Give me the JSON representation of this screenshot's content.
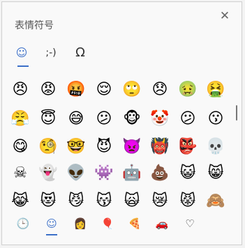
{
  "window": {
    "title": "表情符号",
    "close_glyph": "✕"
  },
  "tabs": [
    {
      "name": "emoji",
      "glyph": "☺"
    },
    {
      "name": "kaomoji",
      "glyph": ";-)"
    },
    {
      "name": "symbols",
      "glyph": "Ω"
    }
  ],
  "emoji_rows": [
    [
      "😠",
      "😡",
      "🤬",
      "😌",
      "🙄",
      "😞",
      "🤢",
      "🤮"
    ],
    [
      "😤",
      "😇",
      "😅",
      "😕",
      "🐵",
      "🤡",
      "😕",
      "😗"
    ],
    [
      "😋",
      "🧐",
      "🤓",
      "😈",
      "👿",
      "👹",
      "👺",
      "💀"
    ],
    [
      "☠",
      "👻",
      "👽",
      "👾",
      "🤖",
      "💩",
      "😺",
      "😸"
    ],
    [
      "😹",
      "😻",
      "😼",
      "😽",
      "🙀",
      "😿",
      "😾",
      "🙈"
    ]
  ],
  "categories": [
    {
      "name": "recent",
      "glyph": "🕒"
    },
    {
      "name": "smileys",
      "glyph": "☺"
    },
    {
      "name": "people",
      "glyph": "👩"
    },
    {
      "name": "celebration",
      "glyph": "🎈"
    },
    {
      "name": "food",
      "glyph": "🍕"
    },
    {
      "name": "transport",
      "glyph": "🚗"
    },
    {
      "name": "symbols",
      "glyph": "♡"
    }
  ],
  "colors": {
    "accent": "#3b6fc8",
    "background": "#f9f9f9"
  }
}
